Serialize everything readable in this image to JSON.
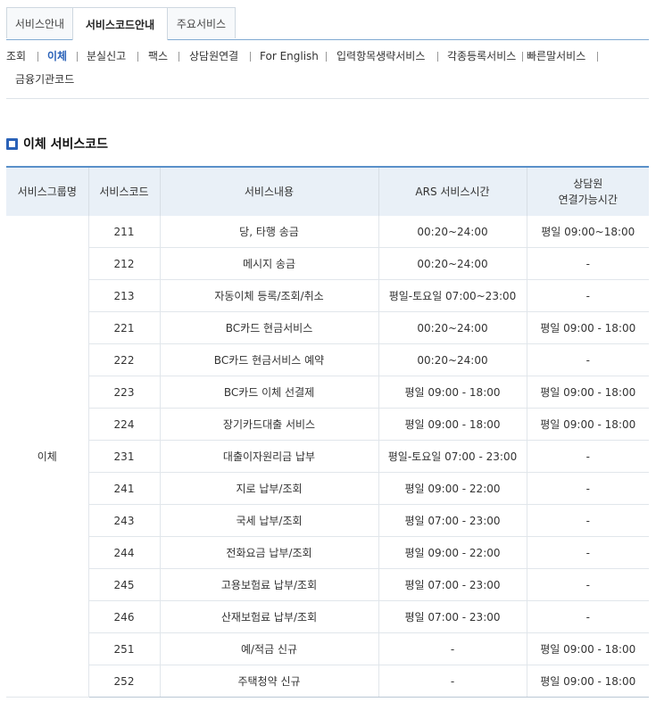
{
  "tabs": [
    {
      "label": "서비스안내",
      "active": false
    },
    {
      "label": "서비스코드안내",
      "active": true
    },
    {
      "label": "주요서비스",
      "active": false
    }
  ],
  "submenu": [
    {
      "label": "조회",
      "active": false
    },
    {
      "label": "이체",
      "active": true
    },
    {
      "label": "분실신고",
      "active": false
    },
    {
      "label": "팩스",
      "active": false
    },
    {
      "label": "상담원연결",
      "active": false
    },
    {
      "label": "For English",
      "active": false
    },
    {
      "label": "입력항목생략서비스",
      "active": false
    },
    {
      "label": "각종등록서비스",
      "active": false
    },
    {
      "label": "빠른말서비스",
      "active": false
    },
    {
      "label": "금융기관코드",
      "active": false
    }
  ],
  "section": {
    "title": "이체 서비스코드"
  },
  "table": {
    "headers": [
      "서비스그룹명",
      "서비스코드",
      "서비스내용",
      "ARS 서비스시간",
      "상담원",
      "연결가능시간"
    ],
    "group": "이체",
    "rows": [
      {
        "code": "211",
        "content": "당, 타행 송금",
        "ars": "00:20~24:00",
        "agent": "평일 09:00~18:00"
      },
      {
        "code": "212",
        "content": "메시지 송금",
        "ars": "00:20~24:00",
        "agent": "-"
      },
      {
        "code": "213",
        "content": "자동이체 등록/조회/취소",
        "ars": "평일-토요일 07:00~23:00",
        "agent": "-"
      },
      {
        "code": "221",
        "content": "BC카드 현금서비스",
        "ars": "00:20~24:00",
        "agent": "평일 09:00 - 18:00"
      },
      {
        "code": "222",
        "content": "BC카드 현금서비스 예약",
        "ars": "00:20~24:00",
        "agent": "-"
      },
      {
        "code": "223",
        "content": "BC카드 이체 선결제",
        "ars": "평일 09:00 - 18:00",
        "agent": "평일 09:00 - 18:00"
      },
      {
        "code": "224",
        "content": "장기카드대출 서비스",
        "ars": "평일 09:00 - 18:00",
        "agent": "평일 09:00 - 18:00"
      },
      {
        "code": "231",
        "content": "대출이자원리금 납부",
        "ars": "평일-토요일 07:00 - 23:00",
        "agent": "-"
      },
      {
        "code": "241",
        "content": "지로 납부/조회",
        "ars": "평일 09:00 - 22:00",
        "agent": "-"
      },
      {
        "code": "243",
        "content": "국세 납부/조회",
        "ars": "평일 07:00 - 23:00",
        "agent": "-"
      },
      {
        "code": "244",
        "content": "전화요금 납부/조회",
        "ars": "평일 09:00 - 22:00",
        "agent": "-"
      },
      {
        "code": "245",
        "content": "고용보험료 납부/조회",
        "ars": "평일 07:00 - 23:00",
        "agent": "-"
      },
      {
        "code": "246",
        "content": "산재보험료 납부/조회",
        "ars": "평일 07:00 - 23:00",
        "agent": "-"
      },
      {
        "code": "251",
        "content": "예/적금 신규",
        "ars": "-",
        "agent": "평일 09:00 - 18:00"
      },
      {
        "code": "252",
        "content": "주택청약 신규",
        "ars": "-",
        "agent": "평일 09:00 - 18:00"
      }
    ]
  },
  "colors": {
    "accent": "#2a62b8",
    "header_bg": "#e9f0f7",
    "table_top_border": "#5a90c9"
  }
}
